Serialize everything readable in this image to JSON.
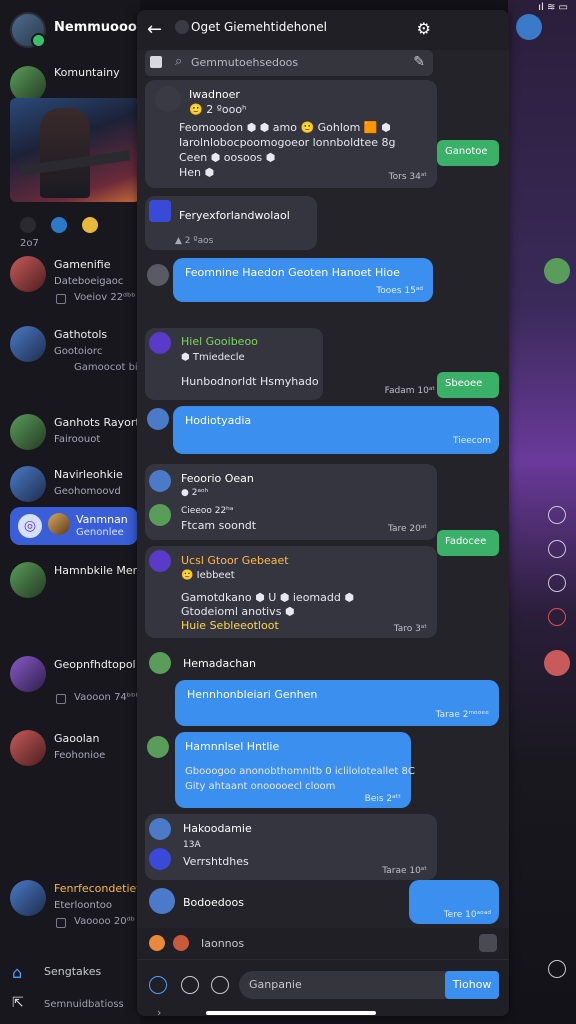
{
  "status_bar": {
    "icons": "ıl ≋ ▭"
  },
  "left_panel": {
    "header_title": "Nemmuooolac",
    "items": [
      {
        "name": "Komuntainy",
        "sub": ""
      },
      {
        "name": "Gamenifie",
        "sub": "Dateboeigaoc",
        "sub2": "Voeiov 22ᵈᵇᵇ"
      },
      {
        "name": "Gathotols",
        "sub": "Gootoiorc",
        "sub2": "Gamoocot bioet"
      },
      {
        "name": "Ganhots Rayorte",
        "sub": "Fairoouot"
      },
      {
        "name": "Navirleohkie",
        "sub": "Geohomoovd"
      },
      {
        "name": "Hamnbkile Mennor",
        "sub": ""
      },
      {
        "name": "Geopnfhdtopol",
        "sub": "",
        "sub2": "Vaooon 74ᵇᵇᵇ"
      },
      {
        "name": "Gaoolan",
        "sub": "Feohonioe"
      },
      {
        "name": "Fenrfecondetiet",
        "sub": "Eterloontoo",
        "sub2": "Vaoooo 20ᵈᵇ"
      }
    ],
    "selected": {
      "title": "Vanmnan",
      "subtitle": "Genonlee"
    },
    "reactions_count": "2o7",
    "footer": {
      "home_label": "Sengtakes",
      "share_label": "Semnuidbatioss"
    }
  },
  "chat": {
    "title": "Oget Giemehtidehonel",
    "search_placeholder": "Gemmutoehsedoos",
    "messages": [
      {
        "name": "Iwadnoer",
        "line1": "🙂 2 ºoooʰ",
        "line2": "Feomoodon ⬢ ⬢ amo 🙂 Gohlom 🟧 ⬢",
        "line3": "Iarolnlobocpoomogoeor lonnboldtee 8g",
        "line4": "Ceen ⬢ oosoos ⬢",
        "line5": "Hen ⬢",
        "time": "Tors 34ᵃᵗ"
      },
      {
        "name": "Feryexforlandwolaol",
        "reply": "▲ 2 ºaos"
      },
      {
        "name": "Feomnine Haedon Geoten Hanoet Hioe",
        "time": "Tooes 15ᵃᵈ"
      },
      {
        "name": "Hiel Gooibeoo",
        "line1": "⬢ Tmiedecle",
        "line2": "Hunbodnorldt Hsmyhado",
        "time": "Fadam 10ᵃᵗ"
      },
      {
        "name": "Hodiotyadia",
        "time": "Tieecom"
      },
      {
        "name": "Feoorio Oean",
        "line1": "● 2ᵃᵒʰ",
        "line2": "Cieeoo 22ʰᵃ",
        "line3": "Ftcam soondt",
        "time": "Tare 20ᵃᵗ"
      },
      {
        "name": "Ucsl Gtoor Gebeaet",
        "line1": "🙂 Iebbeet",
        "line2": "Gamotdkano ⬢ U ⬢ ieomadd ⬢",
        "line3": "Gtodeioml anotivs ⬢",
        "line4": "Huie Sebleeotloot",
        "time": "Taro 3ᵃᵗ"
      },
      {
        "name": "Hemadachan"
      },
      {
        "name": "Hennhonbleiari Genhen",
        "time": "Tarae 2ᵐᵒᵒᵉᵉ"
      },
      {
        "name": "Hamnnlsel Hntlie",
        "line1": "Gbooogoo anonobthomnitb 0 icliloloteallet 8C",
        "line2": "Gity ahtaant onooooecl cloom",
        "time": "Beis 2ᵃᵗᵗ"
      },
      {
        "name": "Hakoodamie",
        "line1": "13A",
        "line2": "Verrshtdhes",
        "time": "Tarae 10ᵃᵗ"
      },
      {
        "name": "Bodoedoos",
        "time": "Tere 10ᵃᵒᵃᵈ"
      }
    ],
    "green_pills": [
      "Ganotoe",
      "Sbeoee",
      "Fadocee"
    ],
    "composer": {
      "reply_label": "Iaonnos",
      "input_placeholder": "Ganpanie",
      "send_label": "Tiohow"
    }
  }
}
